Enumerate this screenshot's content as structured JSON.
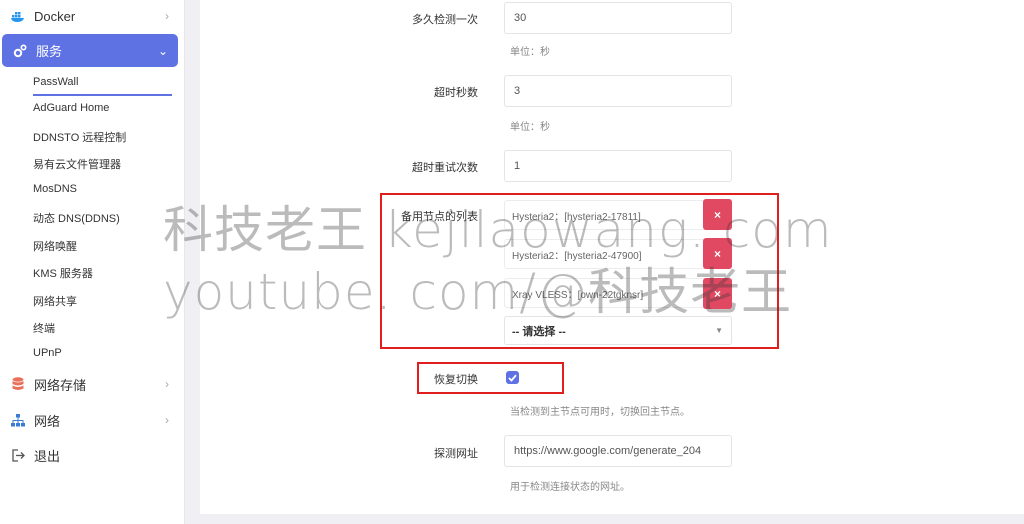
{
  "sidebar": {
    "docker": "Docker",
    "services": "服务",
    "sub_items": [
      "PassWall",
      "AdGuard Home",
      "DDNSTO 远程控制",
      "易有云文件管理器",
      "MosDNS",
      "动态 DNS(DDNS)",
      "网络唤醒",
      "KMS 服务器",
      "网络共享",
      "终端",
      "UPnP"
    ],
    "storage": "网络存储",
    "network": "网络",
    "logout": "退出"
  },
  "form": {
    "interval_label": "多久检测一次",
    "interval_value": "30",
    "interval_unit": "单位：秒",
    "timeout_label": "超时秒数",
    "timeout_value": "3",
    "timeout_unit": "单位：秒",
    "retry_label": "超时重试次数",
    "retry_value": "1",
    "backup_label": "备用节点的列表",
    "backup_nodes": [
      "Hysteria2：[hysteria2-17811]",
      "Hysteria2：[hysteria2-47900]",
      "Xray VLESS：[own-22tgknsr]"
    ],
    "remove_symbol": "×",
    "select_placeholder": "-- 请选择 --",
    "restore_label": "恢复切换",
    "restore_checked": true,
    "restore_hint": "当检测到主节点可用时，切换回主节点。",
    "probe_label": "探测网址",
    "probe_value": "https://www.google.com/generate_204",
    "probe_hint": "用于检测连接状态的网址。"
  },
  "watermark": {
    "line1": "科技老王 kejilaowang. com",
    "line2": "youtube. com/@科技老王"
  },
  "colors": {
    "accent": "#5e72e4",
    "danger": "#e14861",
    "highlight": "#e01e1e"
  }
}
